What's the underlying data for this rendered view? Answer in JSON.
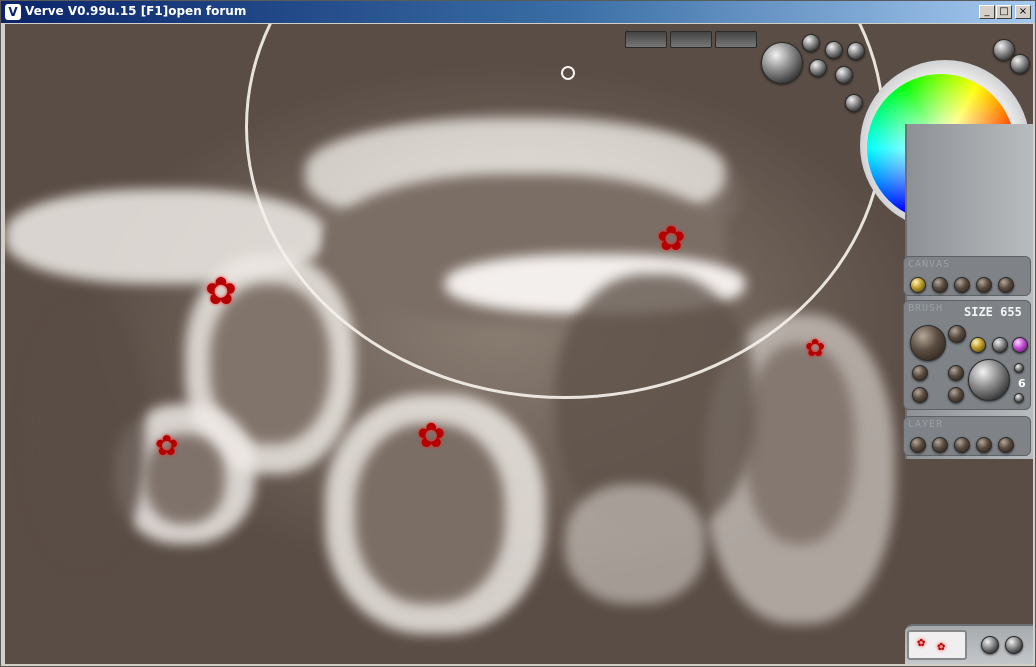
{
  "window": {
    "title": "Verve V0.99u.15 [F1]open forum",
    "icon": "verve-app-icon",
    "minimize_label": "_",
    "maximize_label": "□",
    "close_label": "×"
  },
  "panel": {
    "canvas_label": "CANVAS",
    "brush_label": "BRUSH",
    "size_label": "SIZE 655",
    "layer_label": "LAYER",
    "layer_number": "6"
  },
  "colors": {
    "titlebar_start": "#0a246a",
    "titlebar_end": "#a6caf0",
    "canvas_base": "#6b5e55",
    "paint_red": "#b30000",
    "panel_metal": "#8d9195"
  }
}
